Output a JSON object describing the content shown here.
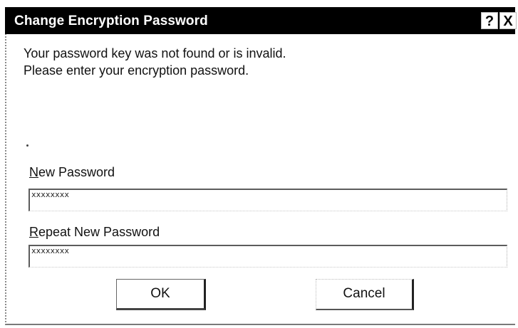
{
  "dialog": {
    "title": "Change Encryption Password",
    "help_label": "?",
    "close_label": "X",
    "message_line1": "Your password key was not found or is invalid.",
    "message_line2": "Please enter your encryption password.",
    "new_password": {
      "label_accel": "N",
      "label_rest": "ew Password",
      "value": "xxxxxxxx"
    },
    "repeat_password": {
      "label_accel": "R",
      "label_rest": "epeat New Password",
      "value": "xxxxxxxx"
    },
    "ok_label": "OK",
    "cancel_label": "Cancel"
  },
  "colors": {
    "titlebar_bg": "#000000",
    "titlebar_text": "#ffffff",
    "window_bg": "#ffffff"
  }
}
